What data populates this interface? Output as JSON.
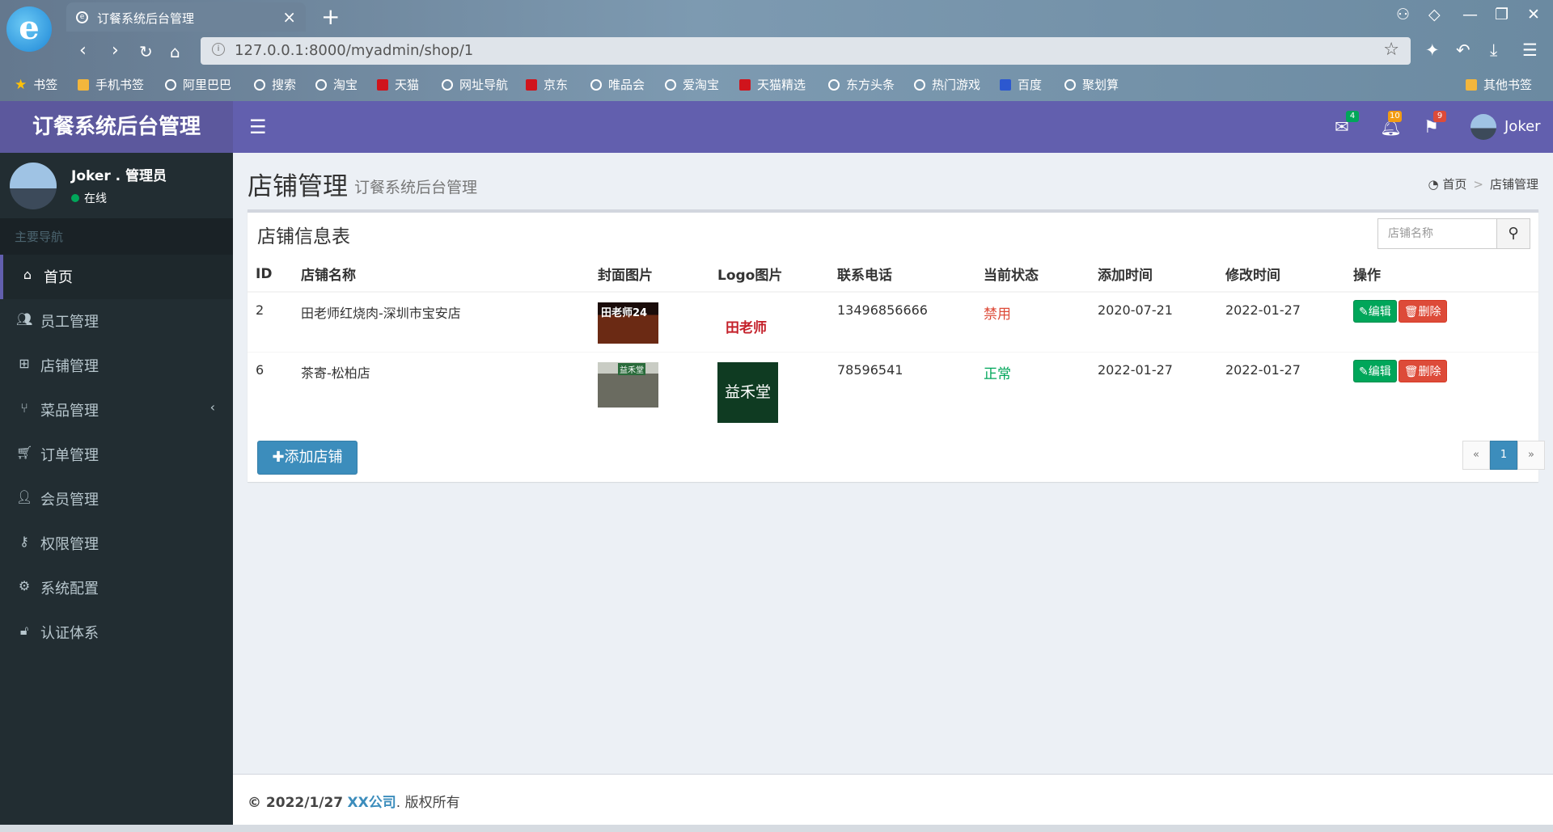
{
  "browser": {
    "tab_title": "订餐系统后台管理",
    "url": "127.0.0.1:8000/myadmin/shop/1",
    "bookmarks": [
      "书签",
      "手机书签",
      "阿里巴巴",
      "搜索",
      "淘宝",
      "天猫",
      "网址导航",
      "京东",
      "唯品会",
      "爱淘宝",
      "天猫精选",
      "东方头条",
      "热门游戏",
      "百度",
      "聚划算"
    ],
    "bookmark_other": "其他书签"
  },
  "header": {
    "brand": "订餐系统后台管理",
    "badges": {
      "mail": "4",
      "bell": "10",
      "flag": "9"
    },
    "user": "Joker"
  },
  "sidebar": {
    "user_name": "Joker . 管理员",
    "status": "在线",
    "section": "主要导航",
    "items": [
      {
        "label": "首页",
        "icon": "home-icon"
      },
      {
        "label": "员工管理",
        "icon": "users-icon"
      },
      {
        "label": "店铺管理",
        "icon": "sitemap-icon"
      },
      {
        "label": "菜品管理",
        "icon": "cutlery-icon"
      },
      {
        "label": "订单管理",
        "icon": "cart-icon"
      },
      {
        "label": "会员管理",
        "icon": "user-icon"
      },
      {
        "label": "权限管理",
        "icon": "key-icon"
      },
      {
        "label": "系统配置",
        "icon": "gear-icon"
      },
      {
        "label": "认证体系",
        "icon": "unlock-icon"
      }
    ]
  },
  "page": {
    "title": "店铺管理",
    "subtitle": "订餐系统后台管理",
    "breadcrumb": [
      "首页",
      "店铺管理"
    ]
  },
  "box": {
    "title": "店铺信息表",
    "search_placeholder": "店铺名称",
    "columns": [
      "ID",
      "店铺名称",
      "封面图片",
      "Logo图片",
      "联系电话",
      "当前状态",
      "添加时间",
      "修改时间",
      "操作"
    ],
    "rows": [
      {
        "id": "2",
        "name": "田老师红烧肉-深圳市宝安店",
        "cover_text": "田老师24",
        "logo_text": "田老师",
        "phone": "13496856666",
        "status": "禁用",
        "added": "2020-07-21",
        "modified": "2022-01-27"
      },
      {
        "id": "6",
        "name": "茶寄-松柏店",
        "cover_text": "益禾堂",
        "logo_text": "益禾堂",
        "phone": "78596541",
        "status": "正常",
        "added": "2022-01-27",
        "modified": "2022-01-27"
      }
    ],
    "edit_label": "编辑",
    "delete_label": "删除",
    "add_label": "添加店铺",
    "pager": {
      "prev": "«",
      "current": "1",
      "next": "»"
    }
  },
  "footer": {
    "copyright": "© 2022/1/27",
    "company": "XX公司",
    "rights": ". 版权所有"
  }
}
